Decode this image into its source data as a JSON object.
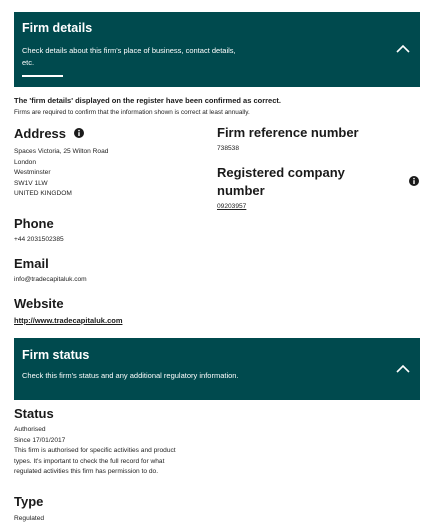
{
  "firm_details": {
    "title": "Firm details",
    "description_line1": "Check details about this firm's place of business, contact details,",
    "description_line2": "etc.",
    "toggle_icon": "chevron-up-icon"
  },
  "confirmation": {
    "strong": "The 'firm details' displayed on the register have been confirmed as correct.",
    "small": "Firms are required to confirm that the information shown is correct at least annually."
  },
  "address": {
    "heading": "Address",
    "icon": "info-icon",
    "lines": [
      "Spaces Victoria, 25 Wilton Road",
      "London",
      "Westminster",
      "SW1V 1LW",
      "UNITED KINGDOM"
    ]
  },
  "frn": {
    "heading": "Firm reference number",
    "value": "738538"
  },
  "company_number": {
    "heading_line1": "Registered company",
    "heading_line2": "number",
    "icon": "info-icon",
    "value": "09203957"
  },
  "phone": {
    "heading": "Phone",
    "value": "+44 2031502385"
  },
  "email": {
    "heading": "Email",
    "value": "info@tradecapitaluk.com"
  },
  "website": {
    "heading": "Website",
    "value": "http://www.tradecapitaluk.com"
  },
  "firm_status": {
    "title": "Firm status",
    "description": "Check this firm's status and any additional regulatory information.",
    "toggle_icon": "chevron-up-icon"
  },
  "status": {
    "heading": "Status",
    "value": "Authorised",
    "since": "Since 17/01/2017",
    "note_lines": [
      "This firm is authorised for specific activities and product",
      "types. It's important to check the full record for what",
      "regulated activities this firm has permission to do."
    ]
  },
  "type": {
    "heading": "Type",
    "value": "Regulated"
  }
}
